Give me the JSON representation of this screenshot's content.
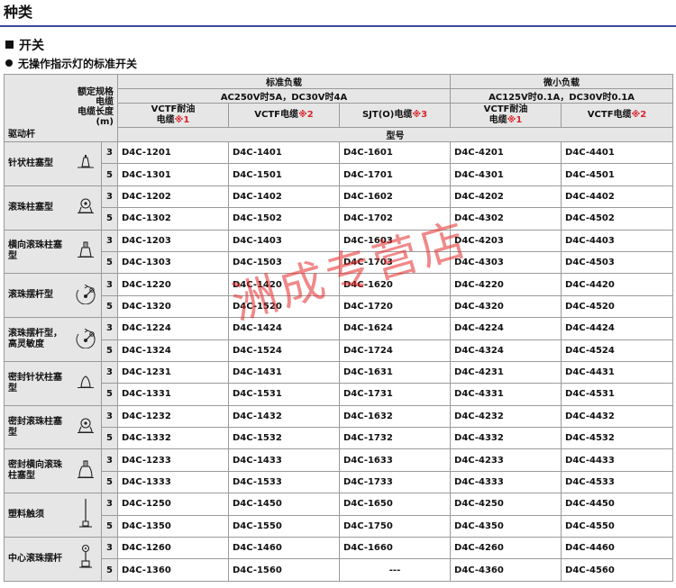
{
  "page_title": "种类",
  "section_title": "开关",
  "subsection_title": "无操作指示灯的标准开关",
  "header": {
    "rating_label_line1": "额定规格",
    "rating_label_line2": "电缆",
    "rating_label_line3": "电缆长度",
    "rating_label_unit": "(m)",
    "actuator_label": "驱动杆",
    "group_standard": "标准负载",
    "group_standard_rating": "AC250V时5A，DC30V时4A",
    "group_micro": "微小负载",
    "group_micro_rating": "AC125V时0.1A，DC30V时0.1A",
    "model_label": "型号",
    "columns": [
      {
        "line1": "VCTF耐油",
        "line2": "电缆",
        "mark": "※1"
      },
      {
        "line1": "VCTF电缆",
        "line2": "",
        "mark": "※2"
      },
      {
        "line1": "SJT(O)电缆",
        "line2": "",
        "mark": "※3"
      },
      {
        "line1": "VCTF耐油",
        "line2": "电缆",
        "mark": "※1"
      },
      {
        "line1": "VCTF电缆",
        "line2": "",
        "mark": "※2"
      }
    ]
  },
  "rows": [
    {
      "name": "针状柱塞型",
      "icon": "pin-plunger-icon",
      "lengths": [
        {
          "len": "3",
          "models": [
            "D4C-1201",
            "D4C-1401",
            "D4C-1601",
            "D4C-4201",
            "D4C-4401"
          ]
        },
        {
          "len": "5",
          "models": [
            "D4C-1301",
            "D4C-1501",
            "D4C-1701",
            "D4C-4301",
            "D4C-4501"
          ]
        }
      ]
    },
    {
      "name": "滚珠柱塞型",
      "icon": "roller-plunger-icon",
      "lengths": [
        {
          "len": "3",
          "models": [
            "D4C-1202",
            "D4C-1402",
            "D4C-1602",
            "D4C-4202",
            "D4C-4402"
          ]
        },
        {
          "len": "5",
          "models": [
            "D4C-1302",
            "D4C-1502",
            "D4C-1702",
            "D4C-4302",
            "D4C-4502"
          ]
        }
      ]
    },
    {
      "name": "横向滚珠柱塞型",
      "icon": "cross-roller-plunger-icon",
      "lengths": [
        {
          "len": "3",
          "models": [
            "D4C-1203",
            "D4C-1403",
            "D4C-1603",
            "D4C-4203",
            "D4C-4403"
          ]
        },
        {
          "len": "5",
          "models": [
            "D4C-1303",
            "D4C-1503",
            "D4C-1703",
            "D4C-4303",
            "D4C-4503"
          ]
        }
      ]
    },
    {
      "name": "滚珠摆杆型",
      "icon": "roller-lever-icon",
      "lengths": [
        {
          "len": "3",
          "models": [
            "D4C-1220",
            "D4C-1420",
            "D4C-1620",
            "D4C-4220",
            "D4C-4420"
          ]
        },
        {
          "len": "5",
          "models": [
            "D4C-1320",
            "D4C-1520",
            "D4C-1720",
            "D4C-4320",
            "D4C-4520"
          ]
        }
      ]
    },
    {
      "name": "滚珠摆杆型，高灵敏度",
      "icon": "roller-lever-high-sensitivity-icon",
      "lengths": [
        {
          "len": "3",
          "models": [
            "D4C-1224",
            "D4C-1424",
            "D4C-1624",
            "D4C-4224",
            "D4C-4424"
          ]
        },
        {
          "len": "5",
          "models": [
            "D4C-1324",
            "D4C-1524",
            "D4C-1724",
            "D4C-4324",
            "D4C-4524"
          ]
        }
      ]
    },
    {
      "name": "密封针状柱塞型",
      "icon": "sealed-pin-plunger-icon",
      "lengths": [
        {
          "len": "3",
          "models": [
            "D4C-1231",
            "D4C-1431",
            "D4C-1631",
            "D4C-4231",
            "D4C-4431"
          ]
        },
        {
          "len": "5",
          "models": [
            "D4C-1331",
            "D4C-1531",
            "D4C-1731",
            "D4C-4331",
            "D4C-4531"
          ]
        }
      ]
    },
    {
      "name": "密封滚珠柱塞型",
      "icon": "sealed-roller-plunger-icon",
      "lengths": [
        {
          "len": "3",
          "models": [
            "D4C-1232",
            "D4C-1432",
            "D4C-1632",
            "D4C-4232",
            "D4C-4432"
          ]
        },
        {
          "len": "5",
          "models": [
            "D4C-1332",
            "D4C-1532",
            "D4C-1732",
            "D4C-4332",
            "D4C-4532"
          ]
        }
      ]
    },
    {
      "name": "密封横向滚珠柱塞型",
      "icon": "sealed-cross-roller-plunger-icon",
      "lengths": [
        {
          "len": "3",
          "models": [
            "D4C-1233",
            "D4C-1433",
            "D4C-1633",
            "D4C-4233",
            "D4C-4433"
          ]
        },
        {
          "len": "5",
          "models": [
            "D4C-1333",
            "D4C-1533",
            "D4C-1733",
            "D4C-4333",
            "D4C-4533"
          ]
        }
      ]
    },
    {
      "name": "塑料触须",
      "icon": "plastic-whisker-icon",
      "lengths": [
        {
          "len": "3",
          "models": [
            "D4C-1250",
            "D4C-1450",
            "D4C-1650",
            "D4C-4250",
            "D4C-4450"
          ]
        },
        {
          "len": "5",
          "models": [
            "D4C-1350",
            "D4C-1550",
            "D4C-1750",
            "D4C-4350",
            "D4C-4550"
          ]
        }
      ]
    },
    {
      "name": "中心滚珠摆杆",
      "icon": "center-roller-lever-icon",
      "lengths": [
        {
          "len": "3",
          "models": [
            "D4C-1260",
            "D4C-1460",
            "D4C-1660",
            "D4C-4260",
            "D4C-4460"
          ]
        },
        {
          "len": "5",
          "models": [
            "D4C-1360",
            "D4C-1560",
            "---",
            "D4C-4360",
            "D4C-4560"
          ]
        }
      ]
    }
  ],
  "watermark": "洲成专营店",
  "colors": {
    "accent_rule": "#3b4a9e",
    "note_mark": "#d9262b",
    "header_bg": "#e6e6e6",
    "watermark": "#e62828"
  }
}
